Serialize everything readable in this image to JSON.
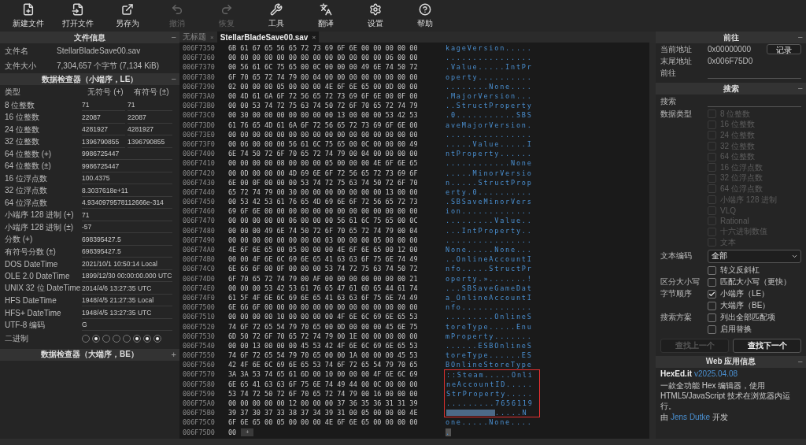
{
  "toolbar": [
    {
      "label": "新建文件",
      "disabled": false
    },
    {
      "label": "打开文件",
      "disabled": false
    },
    {
      "label": "另存为",
      "disabled": false
    },
    {
      "label": "撤消",
      "disabled": true
    },
    {
      "label": "恢复",
      "disabled": true
    },
    {
      "label": "工具",
      "disabled": false
    },
    {
      "label": "翻译",
      "disabled": false
    },
    {
      "label": "设置",
      "disabled": false
    },
    {
      "label": "帮助",
      "disabled": false
    }
  ],
  "left_panel": {
    "file_info": {
      "title": "文件信息",
      "toggle": "−",
      "rows": [
        {
          "label": "文件名",
          "value": "StellarBladeSave00.sav"
        },
        {
          "label": "文件大小",
          "value": "7,304,657 个字节 (7,134 KiB)"
        }
      ]
    },
    "inspector_le": {
      "title": "数据检查器（小端序，LE）",
      "toggle": "−",
      "columns": [
        "类型",
        "无符号 (+)",
        "有符号 (±)"
      ],
      "rows": [
        {
          "label": "8 位整数",
          "unsigned": "71",
          "signed": "71"
        },
        {
          "label": "16 位整数",
          "unsigned": "22087",
          "signed": "22087"
        },
        {
          "label": "24 位整数",
          "unsigned": "4281927",
          "signed": "4281927"
        },
        {
          "label": "32 位整数",
          "unsigned": "1396790855",
          "signed": "1396790855"
        },
        {
          "label": "64 位整数 (+)",
          "value": "9986725447"
        },
        {
          "label": "64 位整数 (±)",
          "value": "9986725447"
        },
        {
          "label": "16 位浮点数",
          "value": "100.4375"
        },
        {
          "label": "32 位浮点数",
          "value": "8.3037618e+11"
        },
        {
          "label": "64 位浮点数",
          "value": "4.9340979578112666e-314"
        },
        {
          "label": "小端序 128 进制 (+)",
          "value": "71"
        },
        {
          "label": "小端序 128 进制 (±)",
          "value": "-57"
        },
        {
          "label": "分数 (+)",
          "value": "698395427.5"
        },
        {
          "label": "有符号分数 (±)",
          "value": "698395427.5"
        },
        {
          "label": "DOS DateTime",
          "value": "2021/10/1 10:50:14 Local"
        },
        {
          "label": "OLE 2.0 DateTime",
          "value": "1899/12/30 00:00:00.000 UTC"
        },
        {
          "label": "UNIX 32 位 DateTime",
          "value": "2014/4/6 13:27:35 UTC"
        },
        {
          "label": "HFS DateTime",
          "value": "1948/4/5 21:27:35 Local"
        },
        {
          "label": "HFS+ DateTime",
          "value": "1948/4/5 13:27:35 UTC"
        },
        {
          "label": "UTF-8 编码",
          "value": "G"
        }
      ],
      "binary": {
        "label": "二进制",
        "bits": [
          {
            "on": false
          },
          {
            "on": true
          },
          {
            "on": false
          },
          {
            "on": false
          },
          {
            "on": false
          },
          {
            "on": true
          },
          {
            "on": true
          },
          {
            "on": true
          }
        ]
      }
    },
    "inspector_be": {
      "title": "数据检查器（大端序，BE）",
      "toggle": "+"
    }
  },
  "tabs": [
    {
      "label": "无标题",
      "close": "×",
      "selected": false
    },
    {
      "label": "StellarBladeSave00.sav",
      "close": "×",
      "selected": true
    }
  ],
  "hex_view": {
    "append_label": "+",
    "rows": [
      {
        "address": "006F7350",
        "hex": "6B 61 67 65 56 65 72 73 69 6F 6E 00 00 00 00 00",
        "ascii": "kageVersion.....",
        "highlighted": false
      },
      {
        "address": "006F7360",
        "hex": "00 00 00 00 00 00 00 00 00 00 00 00 00 06 00 00",
        "ascii": "................",
        "highlighted": false
      },
      {
        "address": "006F7370",
        "hex": "00 56 61 6C 75 65 00 0C 00 00 00 49 6E 74 50 72",
        "ascii": ".Value.....IntPr",
        "highlighted": false
      },
      {
        "address": "006F7380",
        "hex": "6F 70 65 72 74 79 00 04 00 00 00 00 00 00 00 00",
        "ascii": "operty..........",
        "highlighted": false
      },
      {
        "address": "006F7390",
        "hex": "02 00 00 00 05 00 00 00 4E 6F 6E 65 00 0D 00 00",
        "ascii": "........None....",
        "highlighted": false
      },
      {
        "address": "006F73A0",
        "hex": "00 4D 61 6A 6F 72 56 65 72 73 69 6F 6E 00 0F 00",
        "ascii": ".MajorVersion...",
        "highlighted": false
      },
      {
        "address": "006F73B0",
        "hex": "00 00 53 74 72 75 63 74 50 72 6F 70 65 72 74 79",
        "ascii": "..StructProperty",
        "highlighted": false
      },
      {
        "address": "006F73C0",
        "hex": "00 30 00 00 00 00 00 00 00 13 00 00 00 53 42 53",
        "ascii": ".0...........SBS",
        "highlighted": false
      },
      {
        "address": "006F73D0",
        "hex": "61 76 65 4D 61 6A 6F 72 56 65 72 73 69 6F 6E 00",
        "ascii": "aveMajorVersion.",
        "highlighted": false
      },
      {
        "address": "006F73E0",
        "hex": "00 00 00 00 00 00 00 00 00 00 00 00 00 00 00 00",
        "ascii": "................",
        "highlighted": false
      },
      {
        "address": "006F73F0",
        "hex": "00 06 00 00 00 56 61 6C 75 65 00 0C 00 00 00 49",
        "ascii": ".....Value.....I",
        "highlighted": false
      },
      {
        "address": "006F7400",
        "hex": "6E 74 50 72 6F 70 65 72 74 79 00 04 00 00 00 00",
        "ascii": "ntProperty......",
        "highlighted": false
      },
      {
        "address": "006F7410",
        "hex": "00 00 00 00 08 00 00 00 05 00 00 00 4E 6F 6E 65",
        "ascii": "............None",
        "highlighted": false
      },
      {
        "address": "006F7420",
        "hex": "00 0D 00 00 00 4D 69 6E 6F 72 56 65 72 73 69 6F",
        "ascii": ".....MinorVersio",
        "highlighted": false
      },
      {
        "address": "006F7430",
        "hex": "6E 00 0F 00 00 00 53 74 72 75 63 74 50 72 6F 70",
        "ascii": "n.....StructProp",
        "highlighted": false
      },
      {
        "address": "006F7440",
        "hex": "65 72 74 79 00 30 00 00 00 00 00 00 00 13 00 00",
        "ascii": "erty.0..........",
        "highlighted": false
      },
      {
        "address": "006F7450",
        "hex": "00 53 42 53 61 76 65 4D 69 6E 6F 72 56 65 72 73",
        "ascii": ".SBSaveMinorVers",
        "highlighted": false
      },
      {
        "address": "006F7460",
        "hex": "69 6F 6E 00 00 00 00 00 00 00 00 00 00 00 00 00",
        "ascii": "ion.............",
        "highlighted": false
      },
      {
        "address": "006F7470",
        "hex": "00 00 00 00 00 06 00 00 00 56 61 6C 75 65 00 0C",
        "ascii": ".........Value..",
        "highlighted": false
      },
      {
        "address": "006F7480",
        "hex": "00 00 00 49 6E 74 50 72 6F 70 65 72 74 79 00 04",
        "ascii": "...IntProperty..",
        "highlighted": false
      },
      {
        "address": "006F7490",
        "hex": "00 00 00 00 00 00 00 00 03 00 00 00 05 00 00 00",
        "ascii": "................",
        "highlighted": false
      },
      {
        "address": "006F74A0",
        "hex": "4E 6F 6E 65 00 05 00 00 00 4E 6F 6E 65 00 12 00",
        "ascii": "None.....None...",
        "highlighted": false
      },
      {
        "address": "006F74B0",
        "hex": "00 00 4F 6E 6C 69 6E 65 41 63 63 6F 75 6E 74 49",
        "ascii": "..OnlineAccountI",
        "highlighted": false
      },
      {
        "address": "006F74C0",
        "hex": "6E 66 6F 00 0F 00 00 00 53 74 72 75 63 74 50 72",
        "ascii": "nfo.....StructPr",
        "highlighted": false
      },
      {
        "address": "006F74D0",
        "hex": "6F 70 65 72 74 79 00 AF 00 00 00 00 00 00 00 21",
        "ascii": "operty.».......!",
        "highlighted": false
      },
      {
        "address": "006F74E0",
        "hex": "00 00 00 53 42 53 61 76 65 47 61 6D 65 44 61 74",
        "ascii": "...SBSaveGameDat",
        "highlighted": false
      },
      {
        "address": "006F74F0",
        "hex": "61 5F 4F 6E 6C 69 6E 65 41 63 63 6F 75 6E 74 49",
        "ascii": "a_OnlineAccountI",
        "highlighted": false
      },
      {
        "address": "006F7500",
        "hex": "6E 66 6F 00 00 00 00 00 00 00 00 00 00 00 00 00",
        "ascii": "nfo.............",
        "highlighted": false
      },
      {
        "address": "006F7510",
        "hex": "00 00 00 00 10 00 00 00 00 4F 6E 6C 69 6E 65 53",
        "ascii": ".........OnlineS",
        "highlighted": false
      },
      {
        "address": "006F7520",
        "hex": "74 6F 72 65 54 79 70 65 00 0D 00 00 00 45 6E 75",
        "ascii": "toreType.....Enu",
        "highlighted": false
      },
      {
        "address": "006F7530",
        "hex": "6D 50 72 6F 70 65 72 74 79 00 1E 00 00 00 00 00",
        "ascii": "mProperty.......",
        "highlighted": false
      },
      {
        "address": "006F7540",
        "hex": "00 00 13 00 00 00 45 53 42 4F 6E 6C 69 6E 65 53",
        "ascii": "......ESBOnlineS",
        "highlighted": false
      },
      {
        "address": "006F7550",
        "hex": "74 6F 72 65 54 79 70 65 00 00 1A 00 00 00 45 53",
        "ascii": "toreType......ES",
        "highlighted": false
      },
      {
        "address": "006F7560",
        "hex": "42 4F 6E 6C 69 6E 65 53 74 6F 72 65 54 79 70 65",
        "ascii": "BOnlineStoreType",
        "highlighted": false
      },
      {
        "address": "006F7570",
        "hex": "3A 3A 53 74 65 61 6D 00 10 00 00 00 4F 6E 6C 69",
        "ascii": "::Steam.....Onli",
        "highlighted": true
      },
      {
        "address": "006F7580",
        "hex": "6E 65 41 63 63 6F 75 6E 74 49 44 00 0C 00 00 00",
        "ascii": "neAccountID.....",
        "highlighted": true
      },
      {
        "address": "006F7590",
        "hex": "53 74 72 50 72 6F 70 65 72 74 79 00 16 00 00 00",
        "ascii": "StrProperty.....",
        "highlighted": true
      },
      {
        "address": "006F75A0",
        "hex": "00 00 00 00 00 12 00 00 00 37 36 35 36 31 31 39",
        "ascii": ".........7656119",
        "highlighted": true
      },
      {
        "address": "006F75B0",
        "hex": "39 37 30 37 33 38 37 34 39 31 00 05 00 00 00 4E",
        "ascii": ".....N",
        "redacted": true,
        "highlighted": true
      },
      {
        "address": "006F75C0",
        "hex": "6F 6E 65 00 05 00 00 00 4E 6F 6E 65 00 00 00 00",
        "ascii": "one.....None....",
        "highlighted": false
      },
      {
        "address": "006F75D0",
        "hex": "00",
        "ascii": ".",
        "highlighted": false,
        "cursor": true
      }
    ]
  },
  "right_panel": {
    "goto": {
      "title": "前往",
      "toggle": "−",
      "current_label": "当前地址",
      "current_value": "0x00000000",
      "record_button": "记录",
      "end_label": "末尾地址",
      "end_value": "0x006F75D0",
      "goto_label": "前往"
    },
    "search": {
      "title": "搜索",
      "toggle": "−",
      "search_label": "搜索",
      "type_label": "数据类型",
      "types": [
        {
          "label": "8 位整数",
          "checked": false,
          "disabled": true
        },
        {
          "label": "16 位整数",
          "checked": false,
          "disabled": true
        },
        {
          "label": "24 位整数",
          "checked": false,
          "disabled": true
        },
        {
          "label": "32 位整数",
          "checked": false,
          "disabled": true
        },
        {
          "label": "64 位整数",
          "checked": false,
          "disabled": true
        },
        {
          "label": "16 位浮点数",
          "checked": false,
          "disabled": true
        },
        {
          "label": "32 位浮点数",
          "checked": false,
          "disabled": true
        },
        {
          "label": "64 位浮点数",
          "checked": false,
          "disabled": true
        },
        {
          "label": "小端序 128 进制",
          "checked": false,
          "disabled": true
        },
        {
          "label": "VLQ",
          "checked": false,
          "disabled": true
        },
        {
          "label": "Rational",
          "checked": false,
          "disabled": true
        },
        {
          "label": "十六进制数值",
          "checked": false,
          "disabled": true
        },
        {
          "label": "文本",
          "checked": false,
          "disabled": true
        }
      ],
      "encoding_label": "文本编码",
      "encoding_value": "全部",
      "options": [
        {
          "option": "转义反斜杠",
          "checked": false
        },
        {
          "label": "区分大小写",
          "option": "匹配大小写（更快）",
          "checked": false
        },
        {
          "label": "字节顺序",
          "option": "小端序（LE）",
          "checked": true
        },
        {
          "option": "大端序（BE）",
          "checked": false
        },
        {
          "label": "搜索方案",
          "option": "列出全部匹配项",
          "checked": false
        },
        {
          "option": "启用替换",
          "checked": false
        }
      ],
      "buttons": [
        {
          "label": "查找上一个",
          "disabled": true
        },
        {
          "label": "查找下一个",
          "disabled": false
        }
      ]
    },
    "app_info": {
      "title": "Web 应用信息",
      "toggle": "−",
      "name": "HexEd.it",
      "version": "v2025.04.08",
      "description": "一款全功能 Hex 编辑器，使用 HTML5/JavaScript 技术在浏览器内运行。",
      "author_prefix": "由",
      "author": "Jens Dutke",
      "author_suffix": "开发"
    }
  }
}
